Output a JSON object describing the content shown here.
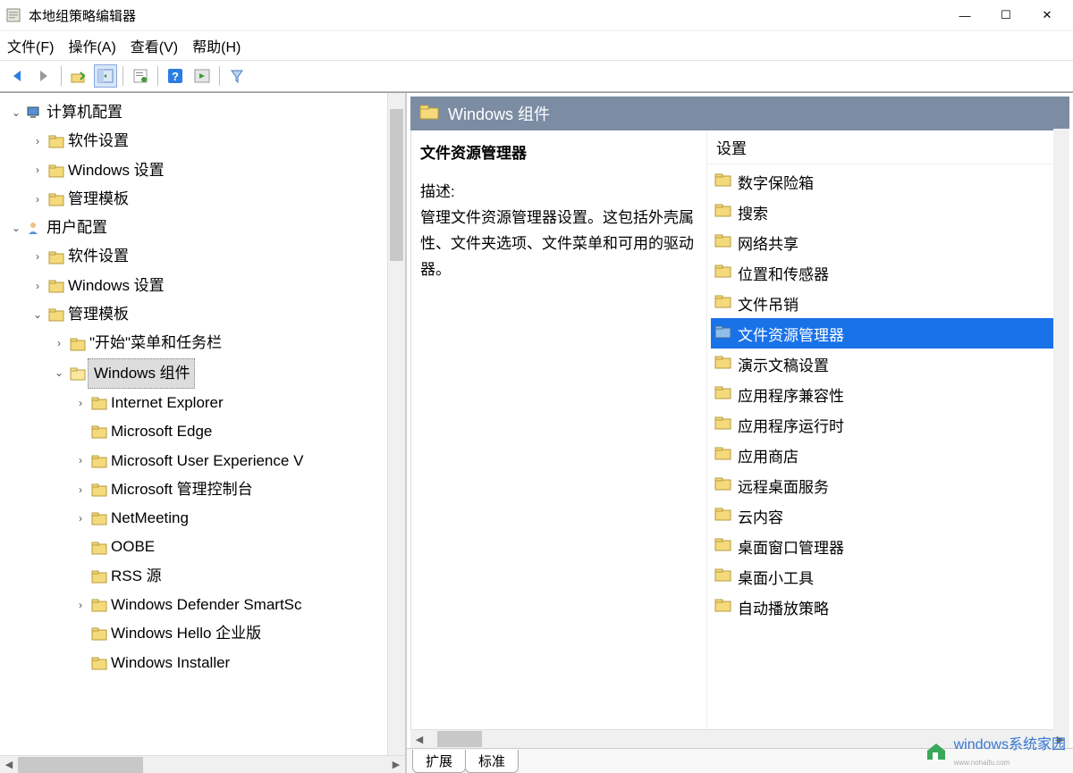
{
  "window": {
    "title": "本地组策略编辑器"
  },
  "menu": {
    "file": "文件(F)",
    "action": "操作(A)",
    "view": "查看(V)",
    "help": "帮助(H)"
  },
  "tree": {
    "computer_config": "计算机配置",
    "cc_software": "软件设置",
    "cc_windows": "Windows 设置",
    "cc_templates": "管理模板",
    "user_config": "用户配置",
    "uc_software": "软件设置",
    "uc_windows": "Windows 设置",
    "uc_templates": "管理模板",
    "start_taskbar": "\"开始\"菜单和任务栏",
    "windows_components": "Windows 组件",
    "wc_ie": "Internet Explorer",
    "wc_edge": "Microsoft Edge",
    "wc_muev": "Microsoft User Experience V",
    "wc_mmc": "Microsoft 管理控制台",
    "wc_netmeeting": "NetMeeting",
    "wc_oobe": "OOBE",
    "wc_rss": "RSS 源",
    "wc_defsc": "Windows Defender SmartSc",
    "wc_hello": "Windows Hello 企业版",
    "wc_installer": "Windows Installer"
  },
  "right": {
    "header": "Windows 组件",
    "desc_title": "文件资源管理器",
    "desc_label": "描述:",
    "desc_body": "管理文件资源管理器设置。这包括外壳属性、文件夹选项、文件菜单和可用的驱动器。",
    "col_header": "设置",
    "items": [
      "数字保险箱",
      "搜索",
      "网络共享",
      "位置和传感器",
      "文件吊销",
      "文件资源管理器",
      "演示文稿设置",
      "应用程序兼容性",
      "应用程序运行时",
      "应用商店",
      "远程桌面服务",
      "云内容",
      "桌面窗口管理器",
      "桌面小工具",
      "自动播放策略"
    ],
    "selected_index": 5
  },
  "tabs": {
    "extended": "扩展",
    "standard": "标准"
  },
  "watermark": {
    "main": "windows系统家园",
    "sub": "www.nohaifu.com"
  }
}
